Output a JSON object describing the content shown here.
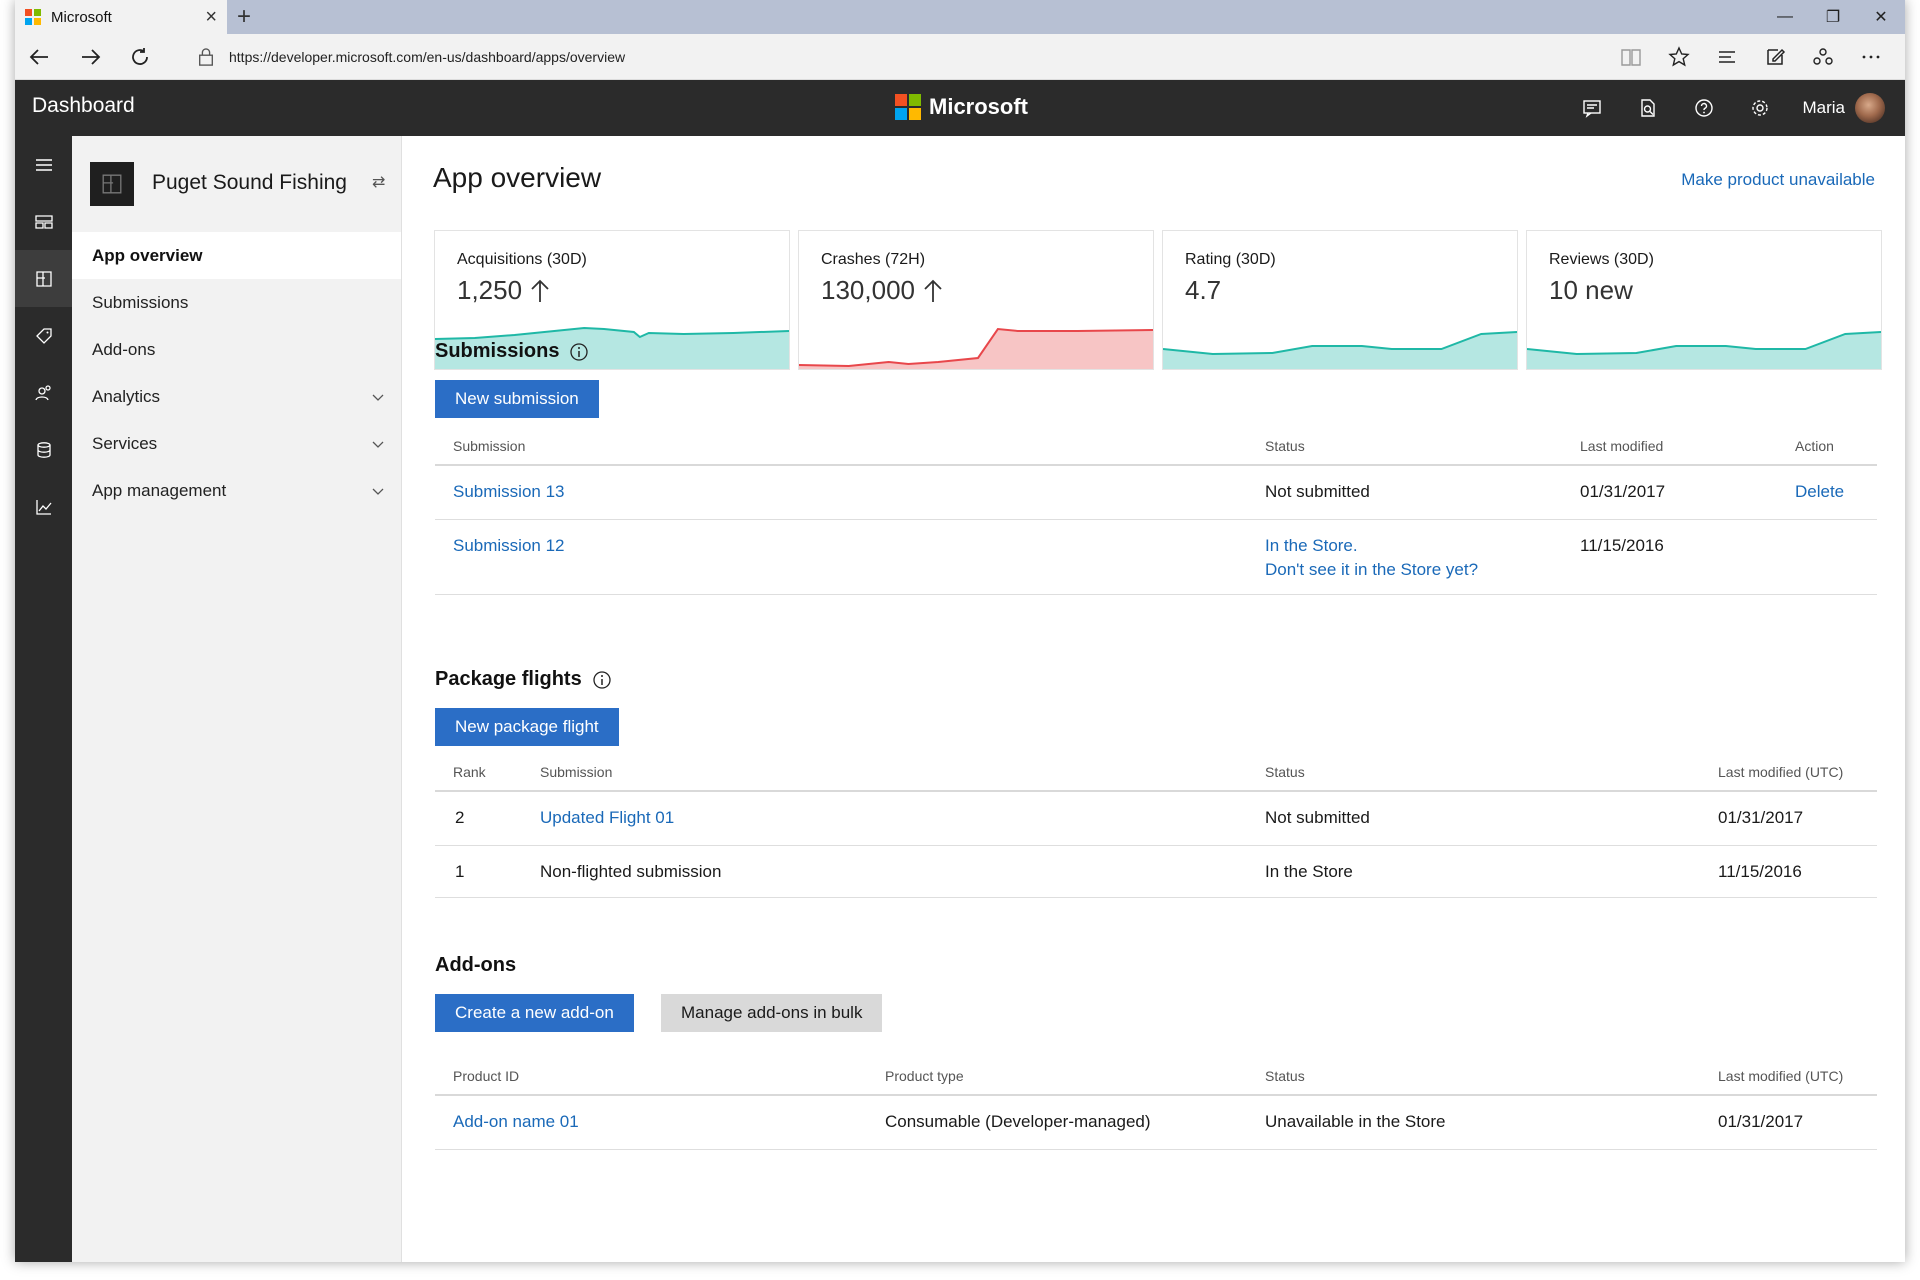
{
  "browser": {
    "tab_title": "Microsoft",
    "url": "https://developer.microsoft.com/en-us/dashboard/apps/overview"
  },
  "colors": {
    "accent": "#2b6ec6",
    "link": "#1a69b8",
    "header_bg": "#2b2b2b",
    "teal_chart": "#1fb8a6",
    "red_chart": "#e8474b"
  },
  "header": {
    "title": "Dashboard",
    "brand": "Microsoft",
    "user": "Maria",
    "icons": [
      "feedback-icon",
      "document-search-icon",
      "help-icon",
      "settings-icon"
    ]
  },
  "rail": {
    "icons": [
      "hamburger-menu-icon",
      "dashboard-icon",
      "apps-icon",
      "tag-icon",
      "people-icon",
      "database-icon",
      "analytics-chart-icon"
    ]
  },
  "sidebar": {
    "app_name": "Puget Sound Fishing",
    "items": [
      {
        "label": "App overview"
      },
      {
        "label": "Submissions"
      },
      {
        "label": "Add-ons"
      },
      {
        "label": "Analytics"
      },
      {
        "label": "Services"
      },
      {
        "label": "App management"
      }
    ]
  },
  "main": {
    "title": "App overview",
    "action_link": "Make product unavailable",
    "cards": [
      {
        "label": "Acquisitions (30D)",
        "value": "1,250"
      },
      {
        "label": "Crashes (72H)",
        "value": "130,000"
      },
      {
        "label": "Rating (30D)",
        "value": "4.7"
      },
      {
        "label": "Reviews (30D)",
        "value": "10 new"
      }
    ],
    "submissions": {
      "heading": "Submissions",
      "button": "New submission",
      "columns": [
        "Submission",
        "Status",
        "Last modified",
        "Action"
      ],
      "rows": [
        {
          "name": "Submission 13",
          "status": "Not submitted",
          "status2": "",
          "modified": "01/31/2017",
          "action": "Delete"
        },
        {
          "name": "Submission 12",
          "status": "In the Store.",
          "status2": "Don't see it in the Store yet?",
          "modified": "11/15/2016",
          "action": ""
        }
      ]
    },
    "flights": {
      "heading": "Package flights",
      "button": "New package flight",
      "columns": [
        "Rank",
        "Submission",
        "Status",
        "Last modified (UTC)"
      ],
      "rows": [
        {
          "rank": "2",
          "name": "Updated Flight 01",
          "status": "Not submitted",
          "modified": "01/31/2017"
        },
        {
          "rank": "1",
          "name": "Non-flighted submission",
          "status": "In the Store",
          "modified": "11/15/2016"
        }
      ]
    },
    "addons": {
      "heading": "Add-ons",
      "button_primary": "Create a new add-on",
      "button_secondary": "Manage add-ons in bulk",
      "columns": [
        "Product ID",
        "Product type",
        "Status",
        "Last modified (UTC)"
      ],
      "rows": [
        {
          "id": "Add-on name 01",
          "type": "Consumable (Developer-managed)",
          "status": "Unavailable in the Store",
          "modified": "01/31/2017"
        }
      ]
    }
  }
}
